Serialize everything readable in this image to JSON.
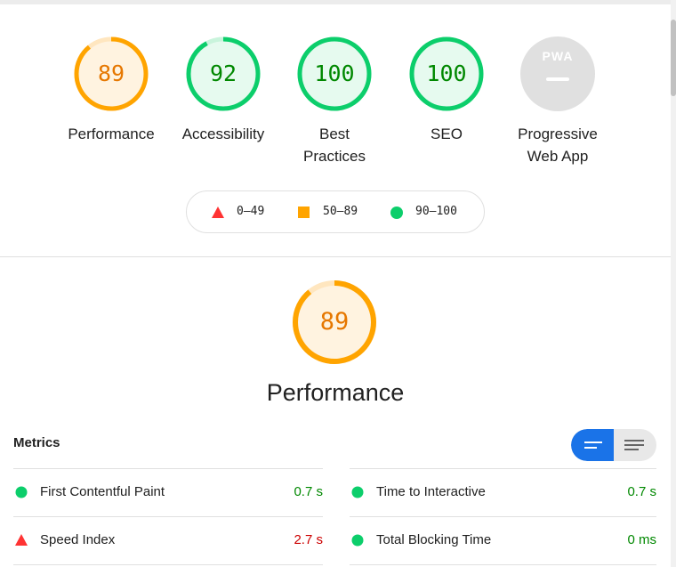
{
  "colors": {
    "fail": "#f33",
    "average": "#ffa400",
    "pass": "#0cce6b",
    "pass_text": "#008800",
    "fail_text": "#cc0000",
    "average_text": "#e67700",
    "pwa_gray": "#bdbdbd",
    "toggle_active": "#1a73e8"
  },
  "summary": {
    "gauges": [
      {
        "score": "89",
        "label_line1": "Performance",
        "label_line2": "",
        "status": "average",
        "fraction": 0.89
      },
      {
        "score": "92",
        "label_line1": "Accessibility",
        "label_line2": "",
        "status": "pass",
        "fraction": 0.92
      },
      {
        "score": "100",
        "label_line1": "Best",
        "label_line2": "Practices",
        "status": "pass",
        "fraction": 1.0
      },
      {
        "score": "100",
        "label_line1": "SEO",
        "label_line2": "",
        "status": "pass",
        "fraction": 1.0
      },
      {
        "score": "PWA",
        "label_line1": "Progressive",
        "label_line2": "Web App",
        "status": "pwa",
        "fraction": 0
      }
    ]
  },
  "legend": {
    "fail_range": "0–49",
    "average_range": "50–89",
    "pass_range": "90–100",
    "fail_icon": "triangle-icon",
    "average_icon": "square-icon",
    "pass_icon": "circle-icon"
  },
  "performance": {
    "score": "89",
    "fraction": 0.89,
    "title": "Performance"
  },
  "metrics": {
    "title": "Metrics",
    "view_toggle": {
      "active_icon": "compact-view-icon",
      "inactive_icon": "expanded-view-icon"
    },
    "items": [
      {
        "name": "First Contentful Paint",
        "value": "0.7 s",
        "status": "pass"
      },
      {
        "name": "Time to Interactive",
        "value": "0.7 s",
        "status": "pass"
      },
      {
        "name": "Speed Index",
        "value": "2.7 s",
        "status": "fail"
      },
      {
        "name": "Total Blocking Time",
        "value": "0 ms",
        "status": "pass"
      }
    ]
  }
}
